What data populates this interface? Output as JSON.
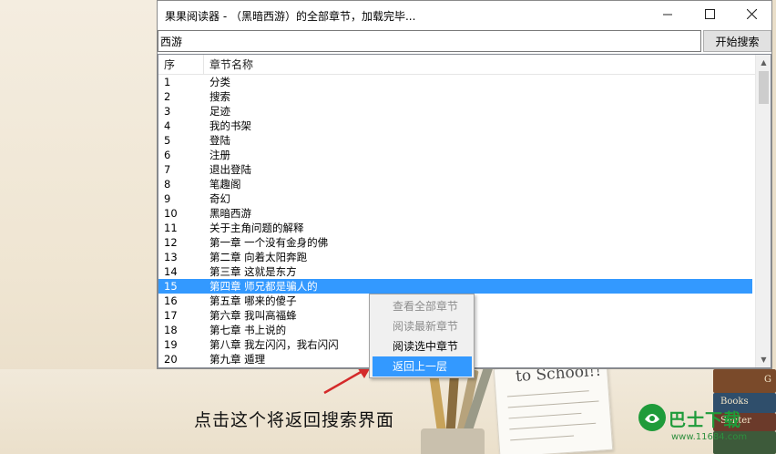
{
  "window": {
    "title": "果果阅读器 - （黑暗西游）的全部章节，加载完毕...",
    "minimize_icon": "minimize-icon",
    "maximize_icon": "maximize-icon",
    "close_icon": "close-icon"
  },
  "search": {
    "value": "西游",
    "button_label": "开始搜索"
  },
  "list": {
    "columns": [
      "序",
      "章节名称"
    ],
    "rows": [
      {
        "no": "1",
        "name": "分类"
      },
      {
        "no": "2",
        "name": "搜索"
      },
      {
        "no": "3",
        "name": "足迹"
      },
      {
        "no": "4",
        "name": "我的书架"
      },
      {
        "no": "5",
        "name": "登陆"
      },
      {
        "no": "6",
        "name": "注册"
      },
      {
        "no": "7",
        "name": "退出登陆"
      },
      {
        "no": "8",
        "name": "笔趣阁"
      },
      {
        "no": "9",
        "name": "奇幻"
      },
      {
        "no": "10",
        "name": "黑暗西游"
      },
      {
        "no": "11",
        "name": "关于主角问题的解释"
      },
      {
        "no": "12",
        "name": "第一章 一个没有金身的佛"
      },
      {
        "no": "13",
        "name": "第二章 向着太阳奔跑"
      },
      {
        "no": "14",
        "name": "第三章 这就是东方"
      },
      {
        "no": "15",
        "name": "第四章 师兄都是骗人的"
      },
      {
        "no": "16",
        "name": "第五章 哪来的傻子"
      },
      {
        "no": "17",
        "name": "第六章 我叫高福蜂"
      },
      {
        "no": "18",
        "name": "第七章 书上说的"
      },
      {
        "no": "19",
        "name": "第八章 我左闪闪，我右闪闪"
      },
      {
        "no": "20",
        "name": "第九章 遁理"
      }
    ],
    "selected_row": "15"
  },
  "context_menu": {
    "items": [
      {
        "label": "查看全部章节",
        "state": "disabled"
      },
      {
        "label": "阅读最新章节",
        "state": "disabled"
      },
      {
        "label": "阅读选中章节",
        "state": "normal"
      },
      {
        "label": "返回上一层",
        "state": "active"
      }
    ]
  },
  "annotation": {
    "caption": "点击这个将返回搜索界面",
    "arrow_color": "#d42a2a"
  },
  "background": {
    "note_text": "to School!!",
    "book_labels": [
      "G",
      "Books",
      "Senter"
    ]
  },
  "watermark": {
    "name": "巴士下载",
    "url": "www.11684.com",
    "color": "#1f9b3a"
  },
  "colors": {
    "selection": "#3399ff",
    "selection_text": "#ffffff",
    "disabled_text": "#8d8d8d"
  }
}
